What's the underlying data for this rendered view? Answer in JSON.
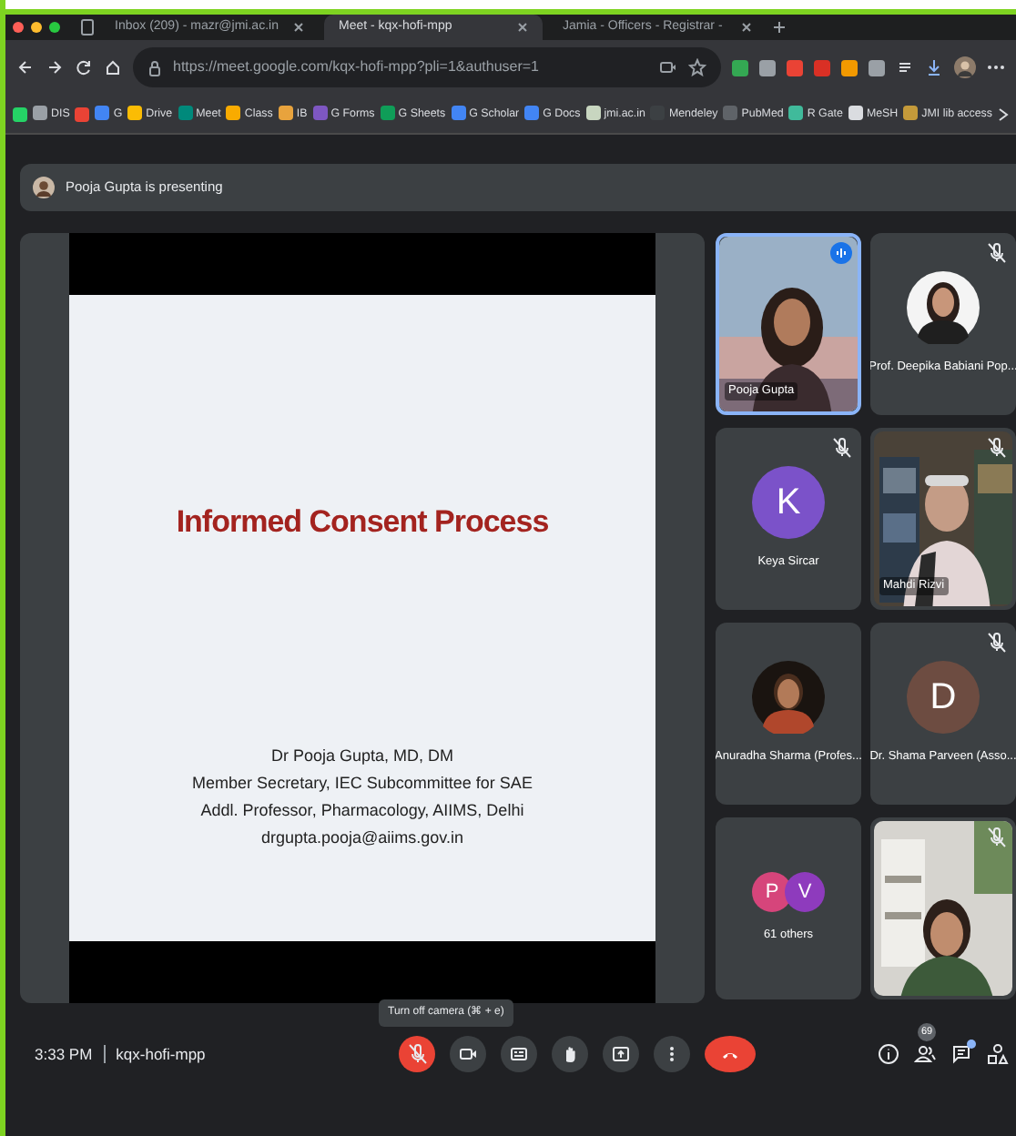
{
  "browser": {
    "tabs": [
      {
        "title": "Inbox (209) - mazr@jmi.ac.in",
        "selected": false
      },
      {
        "title": "Meet - kqx-hofi-mpp",
        "selected": true
      },
      {
        "title": "Jamia - Officers - Registrar -",
        "selected": false
      }
    ],
    "url": "https://meet.google.com/kqx-hofi-mpp?pli=1&authuser=1",
    "extensions": [
      {
        "color": "#34a853"
      },
      {
        "color": "#9aa0a6"
      },
      {
        "color": "#ea4335"
      },
      {
        "color": "#d93025"
      },
      {
        "color": "#f29900"
      },
      {
        "color": "#9aa0a6"
      }
    ],
    "bookmarks": [
      {
        "color": "#25d366"
      },
      {
        "label": "DIS",
        "color": "#9aa0a6"
      },
      {
        "color": "#ea4335"
      },
      {
        "label": "G",
        "color": "#4285f4"
      },
      {
        "label": "Drive",
        "color": "#fbbc04"
      },
      {
        "label": "Meet",
        "color": "#00897b"
      },
      {
        "label": "Class",
        "color": "#f9ab00"
      },
      {
        "label": "IB",
        "color": "#e8a33d"
      },
      {
        "label": "G Forms",
        "color": "#7e57c2"
      },
      {
        "label": "G Sheets",
        "color": "#0f9d58"
      },
      {
        "label": "G Scholar",
        "color": "#4285f4"
      },
      {
        "label": "G Docs",
        "color": "#4285f4"
      },
      {
        "label": "jmi.ac.in",
        "color": "#c8d6c0"
      },
      {
        "label": "Mendeley",
        "color": "#3c4043"
      },
      {
        "label": "PubMed",
        "color": "#5f6368"
      },
      {
        "label": "R Gate",
        "color": "#40ba9b"
      },
      {
        "label": "MeSH",
        "color": "#dadce0"
      },
      {
        "label": "JMI lib access",
        "color": "#c49a3a"
      }
    ]
  },
  "meet": {
    "banner": "Pooja Gupta is presenting",
    "slide": {
      "title": "Informed Consent Process",
      "lines": [
        "Dr Pooja Gupta, MD, DM",
        "Member Secretary, IEC Subcommittee for SAE",
        "Addl. Professor, Pharmacology, AIIMS, Delhi",
        "drgupta.pooja@aiims.gov.in"
      ]
    },
    "tiles": [
      {
        "kind": "video",
        "name": "Pooja Gupta",
        "speaking": true,
        "muted": false
      },
      {
        "name": "Prof. Deepika Babiani Pop...",
        "speaking": false,
        "muted": true
      },
      {
        "kind": "initial",
        "initial": "K",
        "color": "#7b52c9",
        "name": "Keya Sircar",
        "speaking": false,
        "muted": true
      },
      {
        "kind": "video",
        "name": "Mahdi Rizvi",
        "speaking": false,
        "muted": true
      },
      {
        "name": "Anuradha Sharma (Profes...",
        "speaking": false,
        "muted": false
      },
      {
        "kind": "initial",
        "initial": "D",
        "color": "#6d4c41",
        "name": "Dr. Shama Parveen (Asso...",
        "speaking": false,
        "muted": true
      },
      {
        "kind": "others",
        "label": "61 others",
        "avatars": [
          {
            "initial": "P",
            "color": "#d6457b"
          },
          {
            "initial": "V",
            "color": "#8e3bbd"
          }
        ]
      },
      {
        "kind": "video",
        "speaking": false,
        "muted": true
      }
    ],
    "tooltip": "Turn off camera (⌘ + e)",
    "time": "3:33 PM",
    "code": "kqx-hofi-mpp",
    "controls": [
      {
        "kind": "mic",
        "off": true
      },
      {
        "kind": "camera",
        "off": false
      },
      {
        "kind": "captions",
        "off": false
      },
      {
        "kind": "hand",
        "off": false
      },
      {
        "kind": "present",
        "off": false
      },
      {
        "kind": "more",
        "off": false
      },
      {
        "kind": "hangup"
      }
    ],
    "people_count": "69",
    "chat_unread": true
  }
}
